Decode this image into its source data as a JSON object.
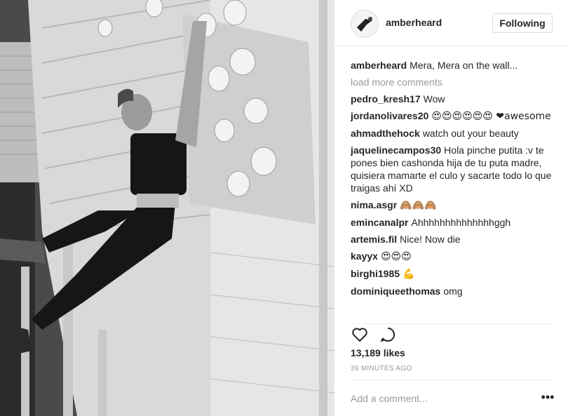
{
  "post": {
    "username": "amberheard",
    "follow_label": "Following",
    "caption_user": "amberheard",
    "caption_text": "Mera, Mera on the wall...",
    "load_more": "load more comments",
    "likes": "13,189 likes",
    "time": "39 MINUTES AGO",
    "comment_placeholder": "Add a comment...",
    "more_options": "•••"
  },
  "comments": [
    {
      "user": "pedro_kresh17",
      "text": "Wow"
    },
    {
      "user": "jordanolivares20",
      "text": "😍😍😍😍😍😍 ❤awesome"
    },
    {
      "user": "ahmadthehock",
      "text": "watch out your beauty"
    },
    {
      "user": "jaquelinecampos30",
      "text": "Hola pinche putita :v te pones bien cashonda hija de tu puta madre, quisiera mamarte el culo y sacarte todo lo que traigas ahí XD"
    },
    {
      "user": "nima.asgr",
      "text": "🙈🙈🙈"
    },
    {
      "user": "emincanalpr",
      "text": "Ahhhhhhhhhhhhhhggh"
    },
    {
      "user": "artemis.fil",
      "text": "Nice! Now die"
    },
    {
      "user": "kayyx",
      "text": "😍😍😍"
    },
    {
      "user": "birghi1985",
      "text": "💪"
    },
    {
      "user": "dominiqueethomas",
      "text": "omg"
    }
  ],
  "icons": {
    "like": "heart-icon",
    "comment": "comment-icon"
  },
  "colors": {
    "text": "#262626",
    "muted": "#999999",
    "border": "#dbdbdb"
  }
}
